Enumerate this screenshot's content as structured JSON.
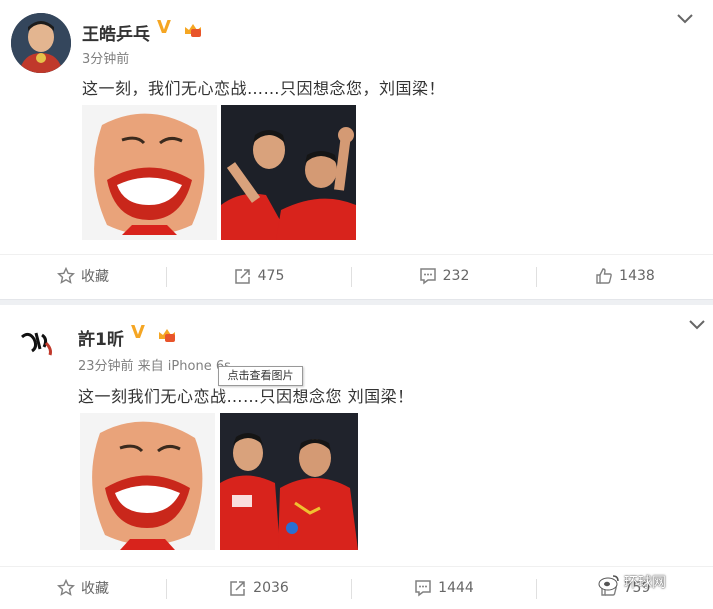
{
  "posts": [
    {
      "author": "王皓乒乓",
      "verified_mark": "V",
      "time": "3分钟前",
      "text": "这一刻，我们无心恋战……只因想念您，刘国梁！",
      "actions": {
        "favorite": "收藏",
        "repost": "475",
        "comment": "232",
        "like": "1438"
      }
    },
    {
      "author": "許1昕",
      "verified_mark": "V",
      "time": "23分钟前 来自 iPhone 6s",
      "text": "这一刻我们无心恋战……只因想念您 刘国梁！",
      "actions": {
        "favorite": "收藏",
        "repost": "2036",
        "comment": "1444",
        "like": "759"
      }
    }
  ],
  "tooltip": "点击查看图片",
  "watermark": "环球网",
  "colors": {
    "verified": "#f5a623",
    "jersey_red": "#d8231c",
    "icon_gray": "#808080"
  }
}
